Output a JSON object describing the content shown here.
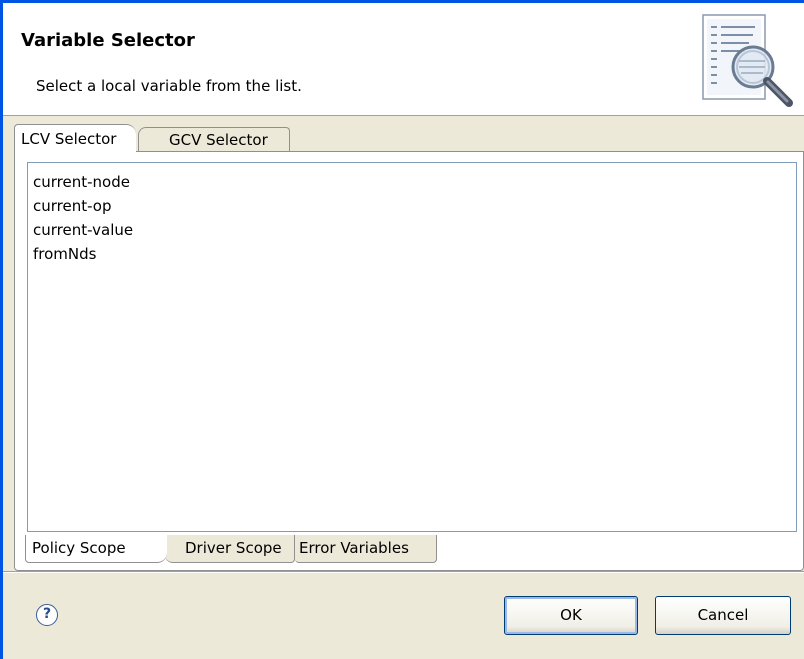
{
  "header": {
    "title": "Variable Selector",
    "description": "Select a local variable from the list.",
    "image_icon": "document-magnifier-icon"
  },
  "outer_tabs": [
    {
      "label": "LCV Selector",
      "active": true
    },
    {
      "label": "GCV Selector",
      "active": false
    }
  ],
  "variables": [
    "current-node",
    "current-op",
    "current-value",
    "fromNds"
  ],
  "inner_tabs": [
    {
      "label": "Policy Scope",
      "active": true
    },
    {
      "label": "Driver Scope",
      "active": false
    },
    {
      "label": "Error Variables",
      "active": false
    }
  ],
  "footer": {
    "help_glyph": "?",
    "ok_label": "OK",
    "cancel_label": "Cancel"
  },
  "colors": {
    "accent": "#0054e3",
    "dialog_bg": "#ece9d8",
    "button_border": "#003c74"
  }
}
